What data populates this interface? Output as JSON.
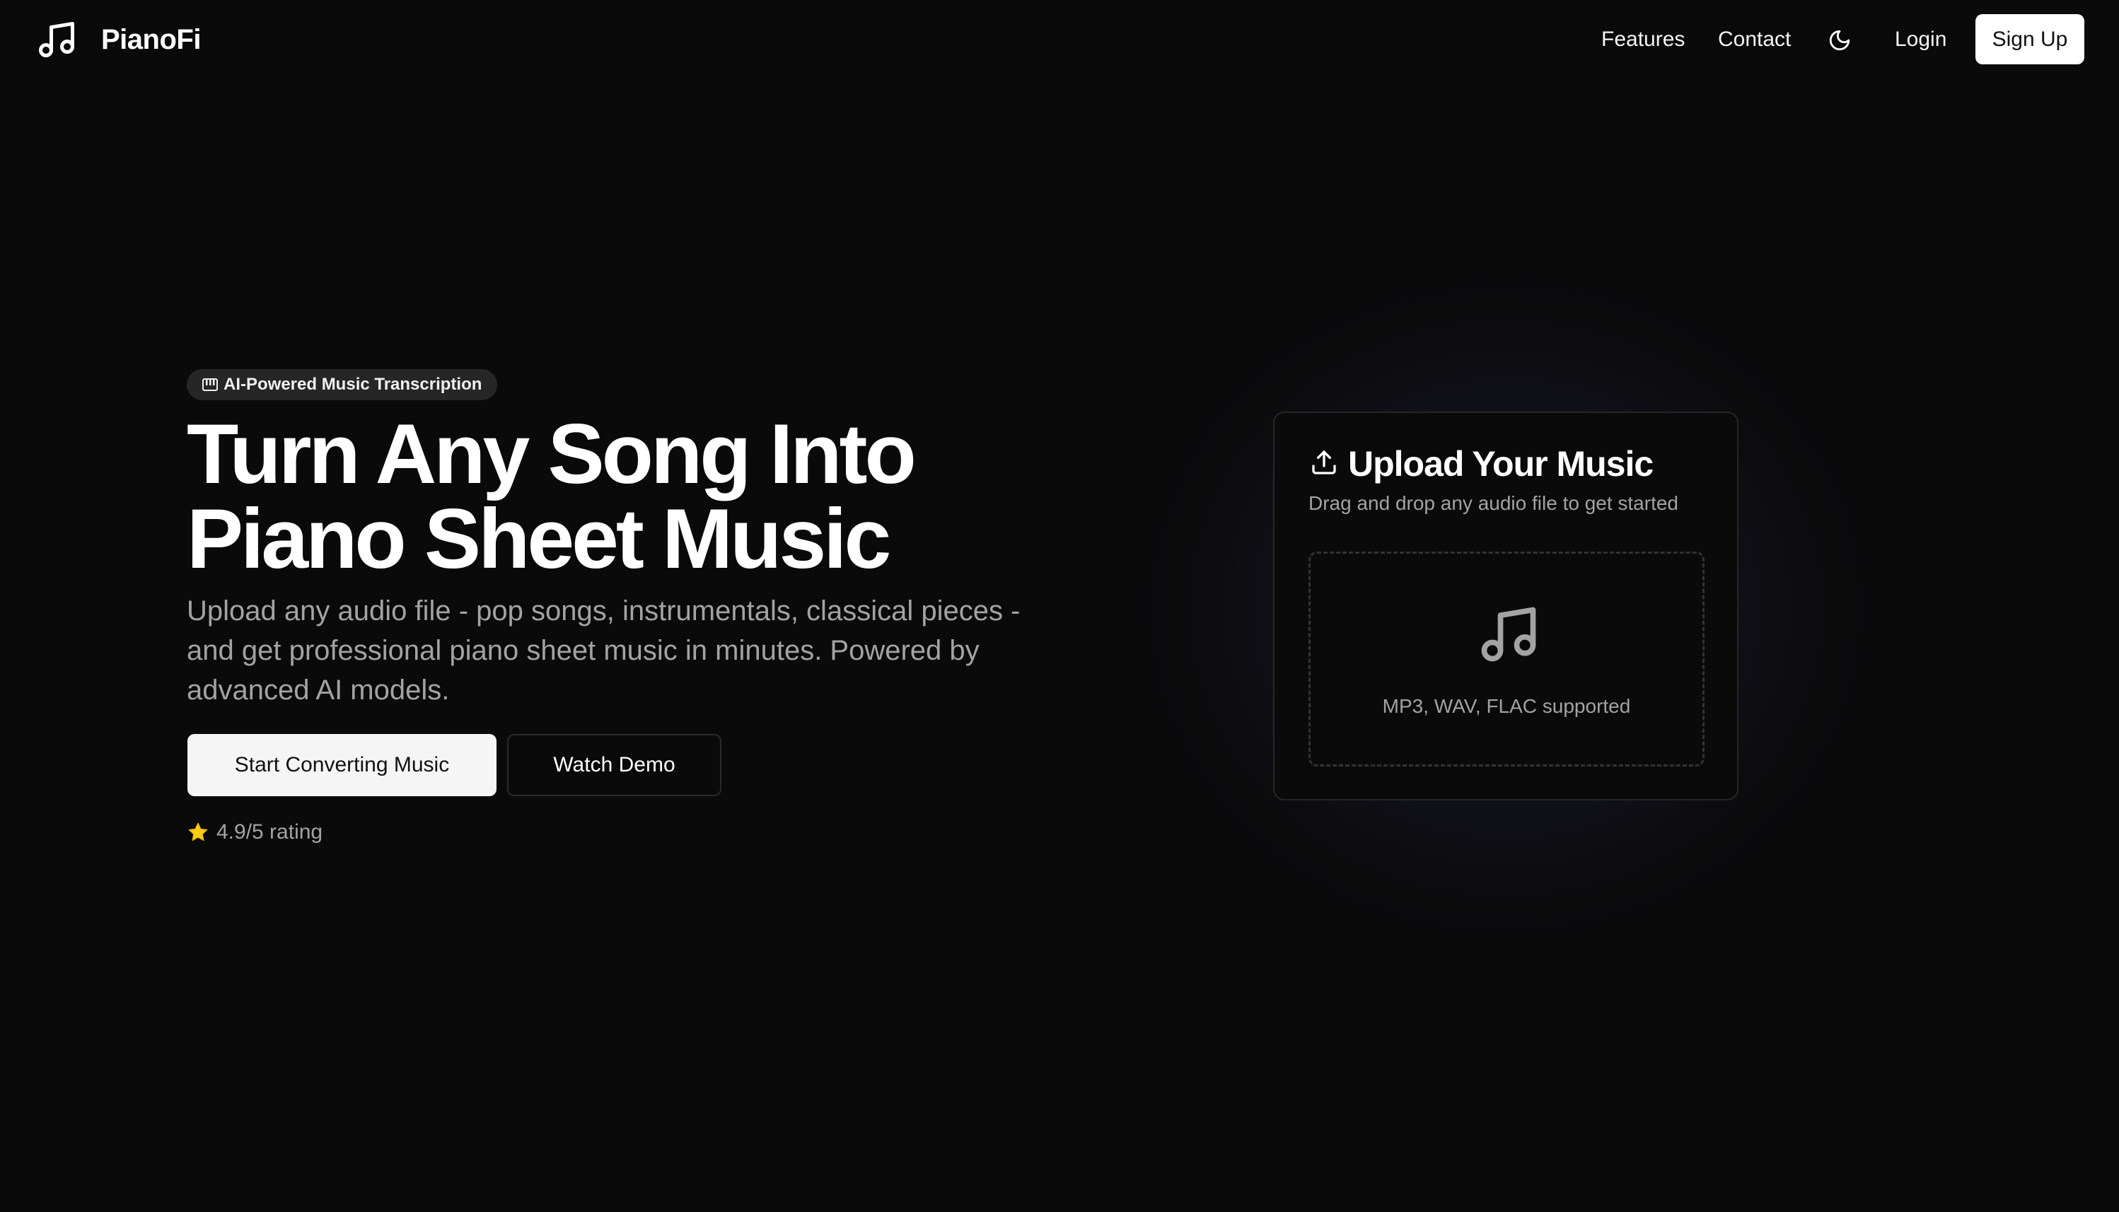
{
  "header": {
    "brand": "PianoFi",
    "nav": {
      "features": "Features",
      "contact": "Contact",
      "login": "Login",
      "signup": "Sign Up"
    },
    "theme_toggle_icon": "moon-icon",
    "logo_icon": "music-note-icon"
  },
  "hero": {
    "badge": {
      "icon": "piano-keys-icon",
      "text": "AI-Powered Music Transcription"
    },
    "title_line1": "Turn Any Song Into",
    "title_line2": "Piano Sheet Music",
    "subtitle": "Upload any audio file - pop songs, instrumentals, classical pieces - and get professional piano sheet music in minutes. Powered by advanced AI models.",
    "primary_button": "Start Converting Music",
    "secondary_button": "Watch Demo",
    "rating": {
      "icon": "star-icon",
      "text": "4.9/5 rating"
    }
  },
  "upload_card": {
    "icon": "upload-icon",
    "title": "Upload Your Music",
    "description": "Drag and drop any audio file to get started",
    "dropzone": {
      "icon": "music-note-icon",
      "text": "MP3, WAV, FLAC supported"
    }
  },
  "colors": {
    "background": "#0a0a0a",
    "text_primary": "#ffffff",
    "text_muted": "#a3a3a3",
    "star": "#facc15",
    "border": "#262626"
  }
}
